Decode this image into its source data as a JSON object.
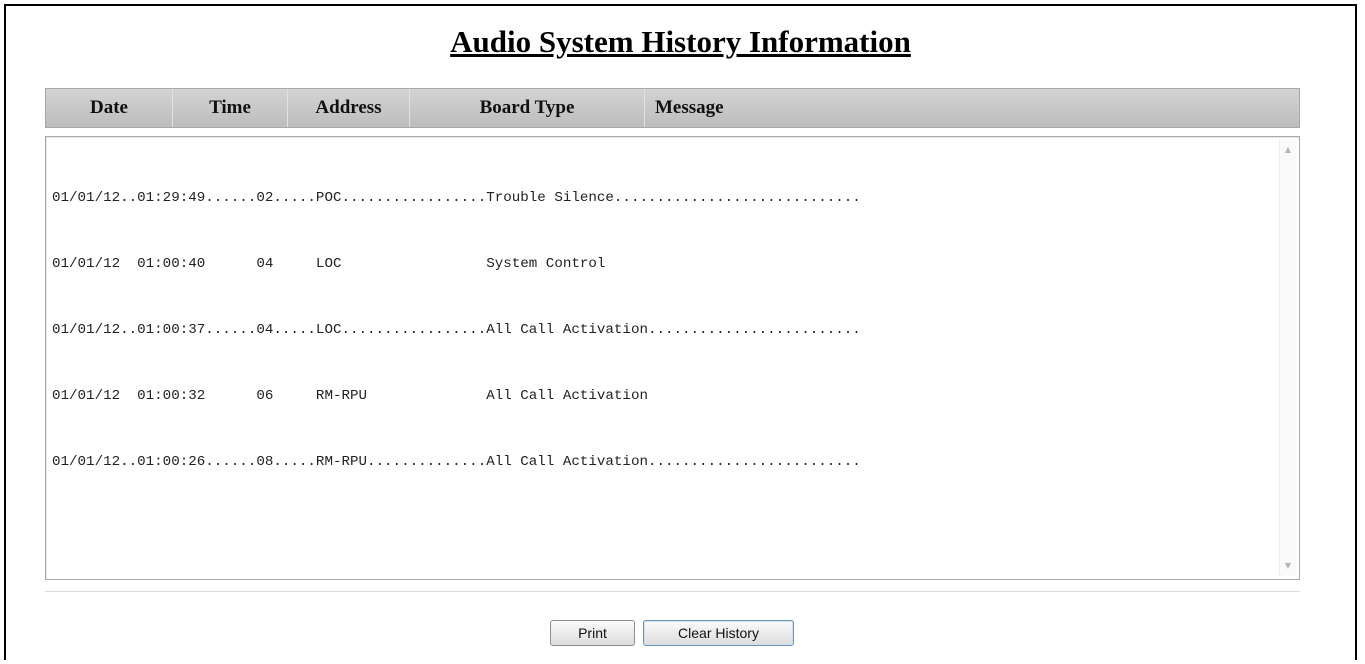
{
  "title": "Audio System History Information",
  "columns": {
    "date": "Date",
    "time": "Time",
    "address": "Address",
    "board_type": "Board Type",
    "message": "Message"
  },
  "history_lines": [
    "01/01/12..01:29:49......02.....POC.................Trouble Silence.............................",
    "01/01/12  01:00:40      04     LOC                 System Control",
    "01/01/12..01:00:37......04.....LOC.................All Call Activation.........................",
    "01/01/12  01:00:32      06     RM-RPU              All Call Activation",
    "01/01/12..01:00:26......08.....RM-RPU..............All Call Activation........................."
  ],
  "buttons": {
    "print": "Print",
    "clear_history": "Clear History"
  },
  "icons": {
    "scroll_up": "scroll-up-arrow",
    "scroll_down": "scroll-down-arrow"
  }
}
